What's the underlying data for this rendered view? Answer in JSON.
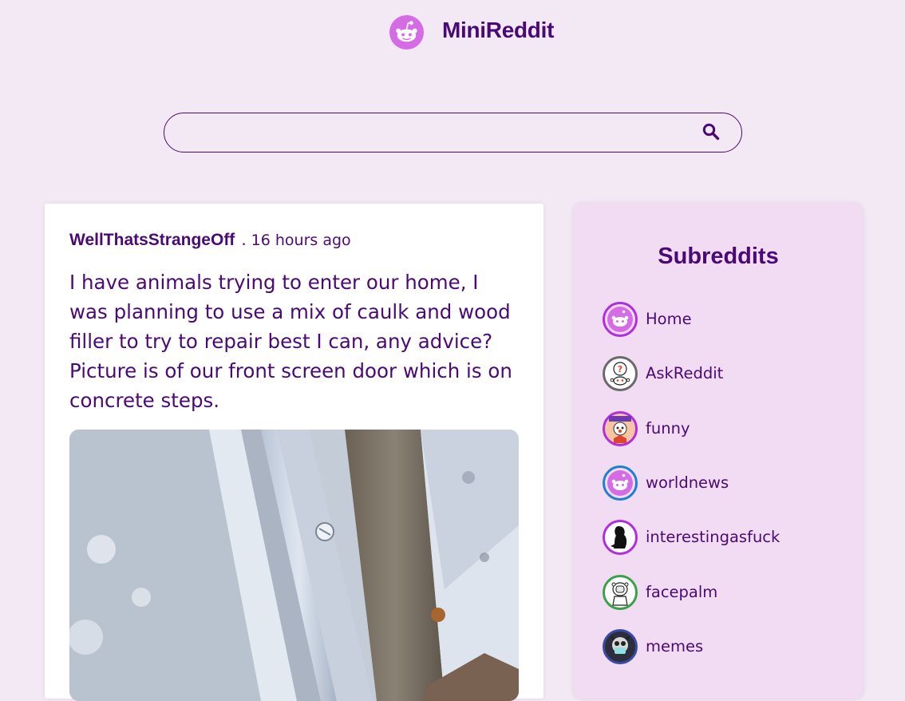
{
  "app": {
    "title": "MiniReddit",
    "logo_icon": "reddit-alien-icon",
    "brand_color": "#4a0a75",
    "accent_color": "#d66be6"
  },
  "search": {
    "placeholder": "",
    "value": "",
    "button_icon": "search-icon"
  },
  "post": {
    "author": "WellThatsStrangeOff",
    "separator": ".",
    "time": "16 hours ago",
    "title": "I have animals trying to enter our home, I was planning to use a mix of caulk and wood filler to try to repair best I can, any advice? Picture is of our front screen door which is on concrete steps."
  },
  "sidebar": {
    "title": "Subreddits",
    "items": [
      {
        "label": "Home",
        "icon": "reddit-alien-icon",
        "ring_color": "#b02ee0"
      },
      {
        "label": "AskReddit",
        "icon": "askreddit-icon",
        "ring_color": "#6a6a6a"
      },
      {
        "label": "funny",
        "icon": "funny-icon",
        "ring_color": "#b02ee0"
      },
      {
        "label": "worldnews",
        "icon": "reddit-alien-icon",
        "ring_color": "#1f7fd1"
      },
      {
        "label": "interestingasfuck",
        "icon": "silhouette-icon",
        "ring_color": "#b02ee0"
      },
      {
        "label": "facepalm",
        "icon": "facepalm-icon",
        "ring_color": "#3aa04a"
      },
      {
        "label": "memes",
        "icon": "memes-icon",
        "ring_color": "#3b4aa0"
      }
    ]
  }
}
